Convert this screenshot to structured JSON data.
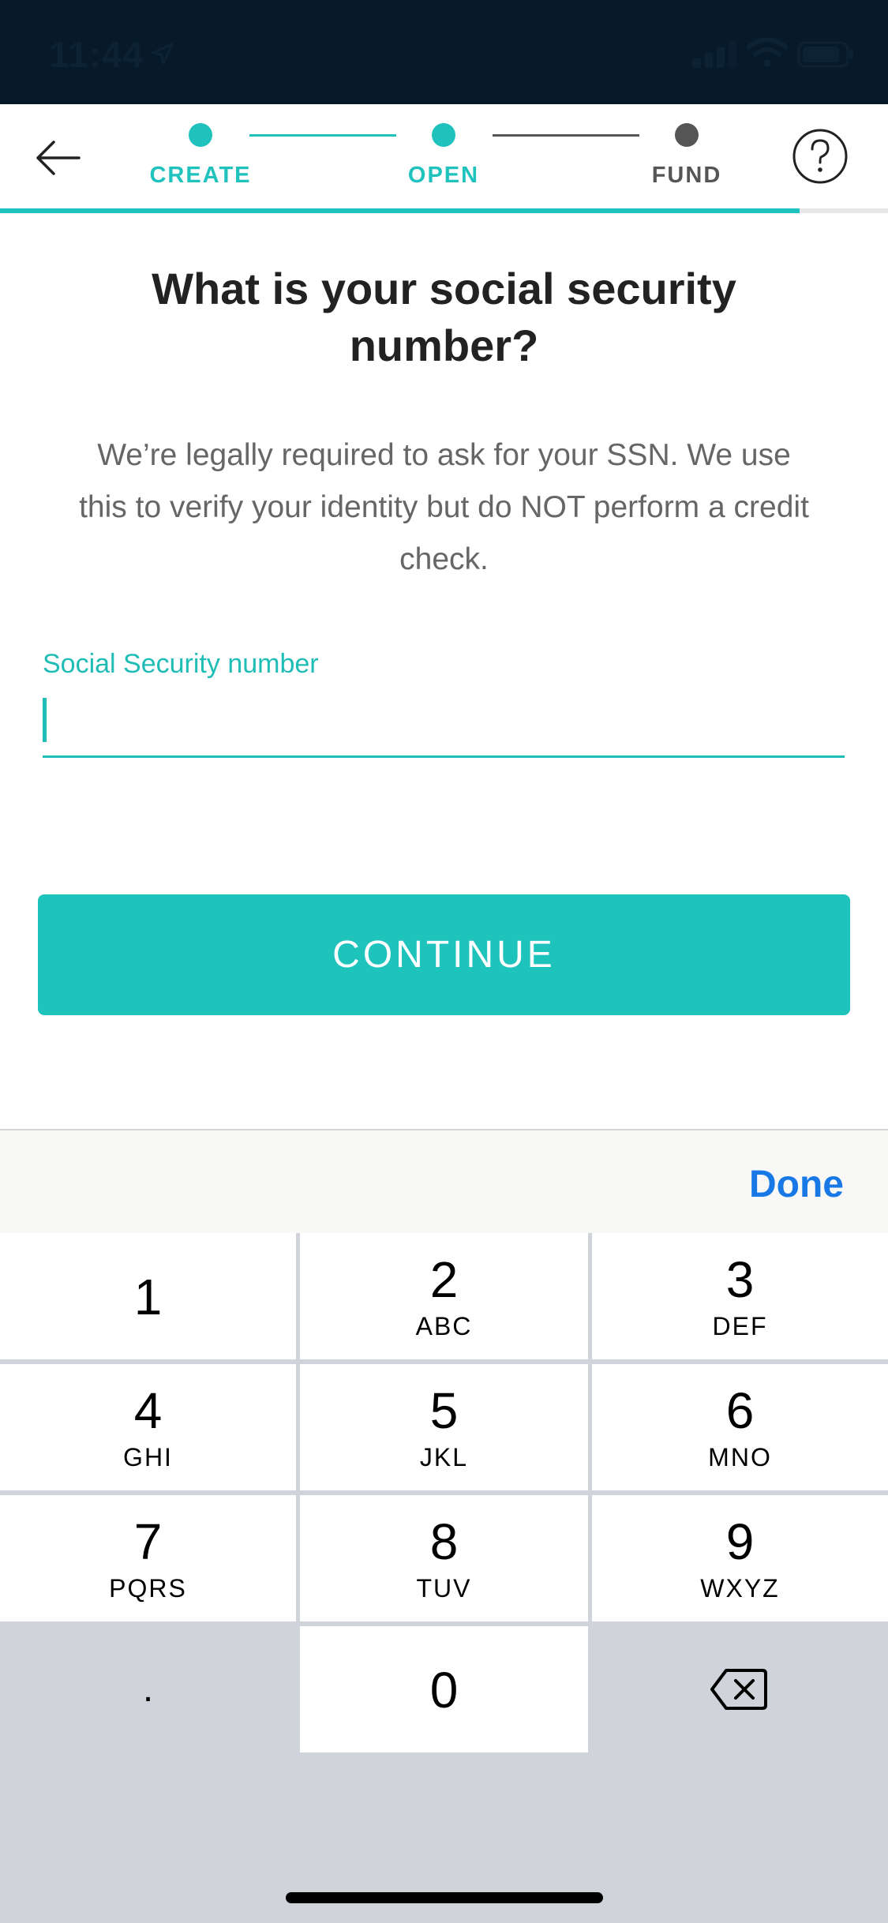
{
  "status_bar": {
    "time": "11:44"
  },
  "header": {
    "steps": [
      {
        "label": "CREATE",
        "state": "complete"
      },
      {
        "label": "OPEN",
        "state": "current"
      },
      {
        "label": "FUND",
        "state": "upcoming"
      }
    ],
    "progress_fraction": 0.9
  },
  "main": {
    "title": "What is your social security number?",
    "subtitle": "We’re legally required to ask for your SSN. We use this to verify your identity but do NOT perform a credit check.",
    "ssn_field": {
      "label": "Social Security number",
      "value": ""
    },
    "continue_label": "CONTINUE"
  },
  "keyboard": {
    "done_label": "Done",
    "keys": [
      {
        "digit": "1",
        "letters": ""
      },
      {
        "digit": "2",
        "letters": "ABC"
      },
      {
        "digit": "3",
        "letters": "DEF"
      },
      {
        "digit": "4",
        "letters": "GHI"
      },
      {
        "digit": "5",
        "letters": "JKL"
      },
      {
        "digit": "6",
        "letters": "MNO"
      },
      {
        "digit": "7",
        "letters": "PQRS"
      },
      {
        "digit": "8",
        "letters": "TUV"
      },
      {
        "digit": "9",
        "letters": "WXYZ"
      }
    ],
    "decimal": ".",
    "zero": "0"
  },
  "colors": {
    "accent": "#1fc2bc",
    "status_bar_bg": "#071a29",
    "link_blue": "#1878e6",
    "inactive_gray": "#666666"
  }
}
